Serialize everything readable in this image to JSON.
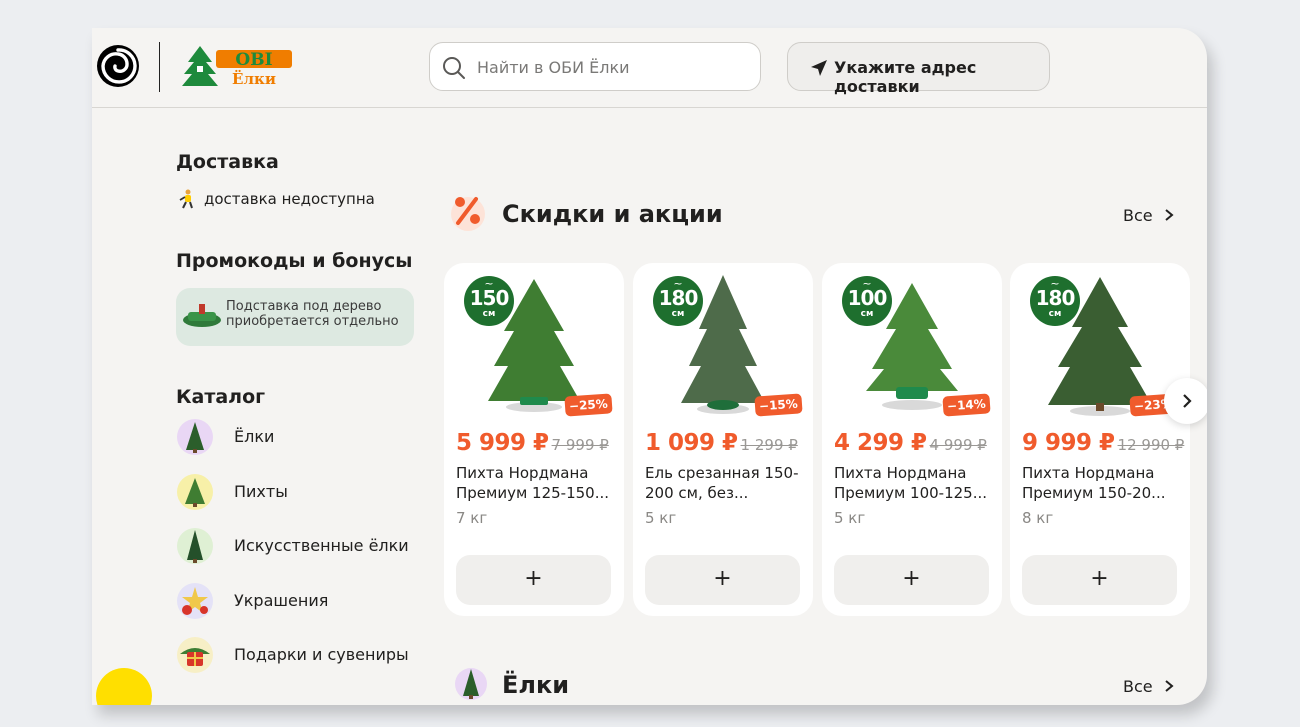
{
  "header": {
    "logo_brand": "OBI",
    "logo_sub": "Ёлки",
    "search_placeholder": "Найти в ОБИ Ёлки",
    "address_button": "Укажите адрес доставки"
  },
  "sidebar": {
    "delivery_title": "Доставка",
    "delivery_status": "доставка недоступна",
    "promo_title": "Промокоды и бонусы",
    "promo_text": "Подставка под дерево приобретается отдельно",
    "catalog_title": "Каталог",
    "catalog": [
      {
        "label": "Ёлки",
        "icon": "fir-tree-icon"
      },
      {
        "label": "Пихты",
        "icon": "fir-tree-icon"
      },
      {
        "label": "Искусственные ёлки",
        "icon": "artificial-tree-icon"
      },
      {
        "label": "Украшения",
        "icon": "ornaments-icon"
      },
      {
        "label": "Подарки и сувениры",
        "icon": "gift-icon"
      }
    ]
  },
  "main": {
    "section1_title": "Скидки и акции",
    "section1_all": "Все",
    "section2_title": "Ёлки",
    "section2_all": "Все",
    "products": [
      {
        "size_tilde": "~",
        "size": "150",
        "unit": "см",
        "discount": "−25%",
        "price": "5 999 ₽",
        "old_price": "7 999 ₽",
        "name": "Пихта Нордмана\nПремиум 125-150...",
        "weight": "7 кг",
        "add": "+"
      },
      {
        "size_tilde": "~",
        "size": "180",
        "unit": "см",
        "discount": "−15%",
        "price": "1 099 ₽",
        "old_price": "1 299 ₽",
        "name": "Ель срезанная 150-\n200 см, без...",
        "weight": "5 кг",
        "add": "+"
      },
      {
        "size_tilde": "~",
        "size": "100",
        "unit": "см",
        "discount": "−14%",
        "price": "4 299 ₽",
        "old_price": "4 999 ₽",
        "name": "Пихта Нордмана\nПремиум 100-125...",
        "weight": "5 кг",
        "add": "+"
      },
      {
        "size_tilde": "~",
        "size": "180",
        "unit": "см",
        "discount": "−23%",
        "price": "9 999 ₽",
        "old_price": "12 990 ₽",
        "name": "Пихта Нордмана\nПремиум 150-20...",
        "weight": "8 кг",
        "add": "+"
      }
    ]
  },
  "colors": {
    "accent_price": "#f05b2c",
    "badge_green": "#1e6f2e",
    "promo_bg": "#dde9e1",
    "logo_orange": "#f07d00",
    "logo_green": "#1e8a3c"
  }
}
